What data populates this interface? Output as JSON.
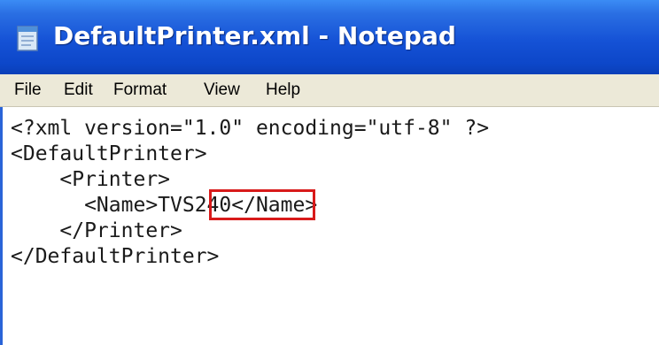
{
  "window": {
    "title": "DefaultPrinter.xml - Notepad",
    "icon": "notepad-icon",
    "titlebar_color": "#1552d6"
  },
  "menu": {
    "items": [
      "File",
      "Edit",
      "Format",
      "View",
      "Help"
    ]
  },
  "editor": {
    "lines": [
      "<?xml version=\"1.0\" encoding=\"utf-8\" ?>",
      "<DefaultPrinter>",
      "    <Printer>",
      "      <Name>TVS240</Name>",
      "    </Printer>",
      "</DefaultPrinter>"
    ],
    "highlighted_value": "TVS240",
    "highlight_color": "#d81a1a"
  }
}
